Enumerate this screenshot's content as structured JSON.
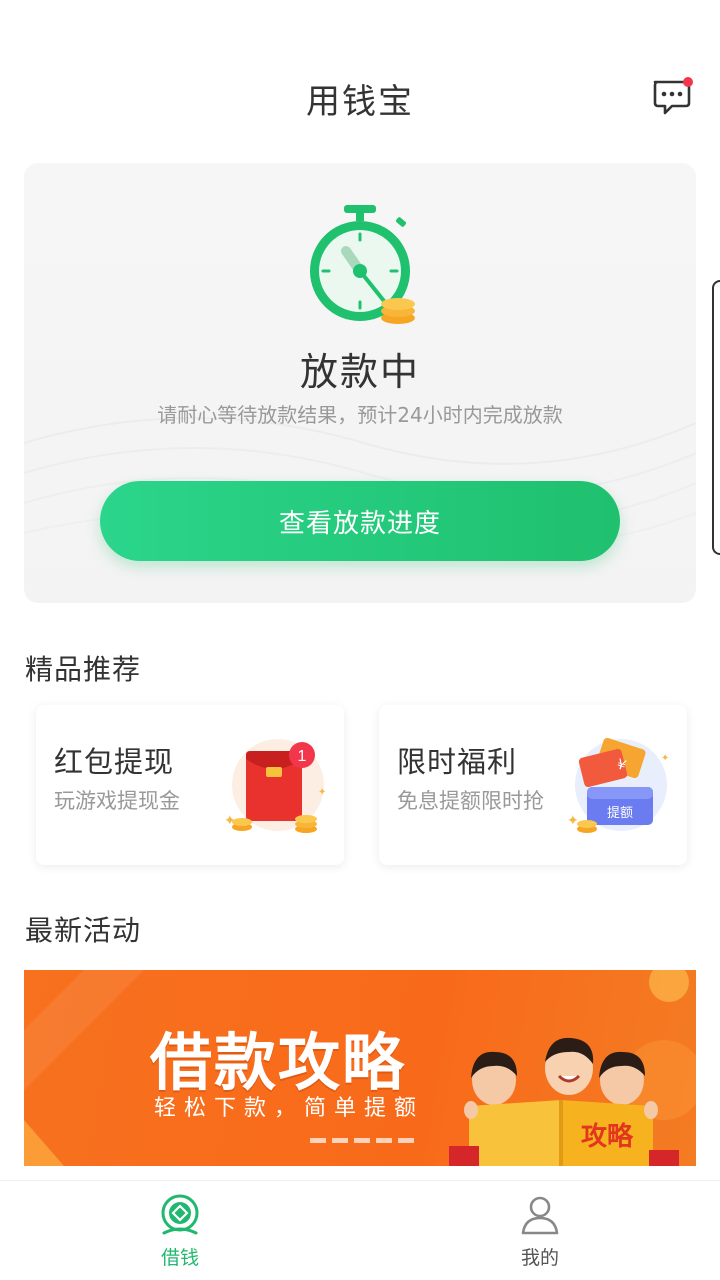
{
  "header": {
    "title": "用钱宝"
  },
  "status": {
    "title": "放款中",
    "description": "请耐心等待放款结果，预计24小时内完成放款",
    "button_label": "查看放款进度"
  },
  "recommend": {
    "section_title": "精品推荐",
    "cards": [
      {
        "title": "红包提现",
        "subtitle": "玩游戏提现金",
        "badge": "1",
        "icon": "red-envelope-icon"
      },
      {
        "title": "限时福利",
        "subtitle": "免息提额限时抢",
        "tag": "提额",
        "icon": "coupon-ticket-icon"
      }
    ]
  },
  "activities": {
    "section_title": "最新活动",
    "banner": {
      "title": "借款攻略",
      "subtitle": "轻松下款，简单提额",
      "book_text": "攻略",
      "slides": 5
    }
  },
  "tabbar": {
    "items": [
      {
        "label": "借钱",
        "icon": "loan-icon",
        "active": true
      },
      {
        "label": "我的",
        "icon": "user-icon",
        "active": false
      }
    ],
    "active_color": "#1fb86e",
    "inactive_color": "#555555"
  },
  "colors": {
    "accent_green": "#1fc06e",
    "banner_orange": "#f7711f",
    "badge_red": "#f2374c"
  }
}
